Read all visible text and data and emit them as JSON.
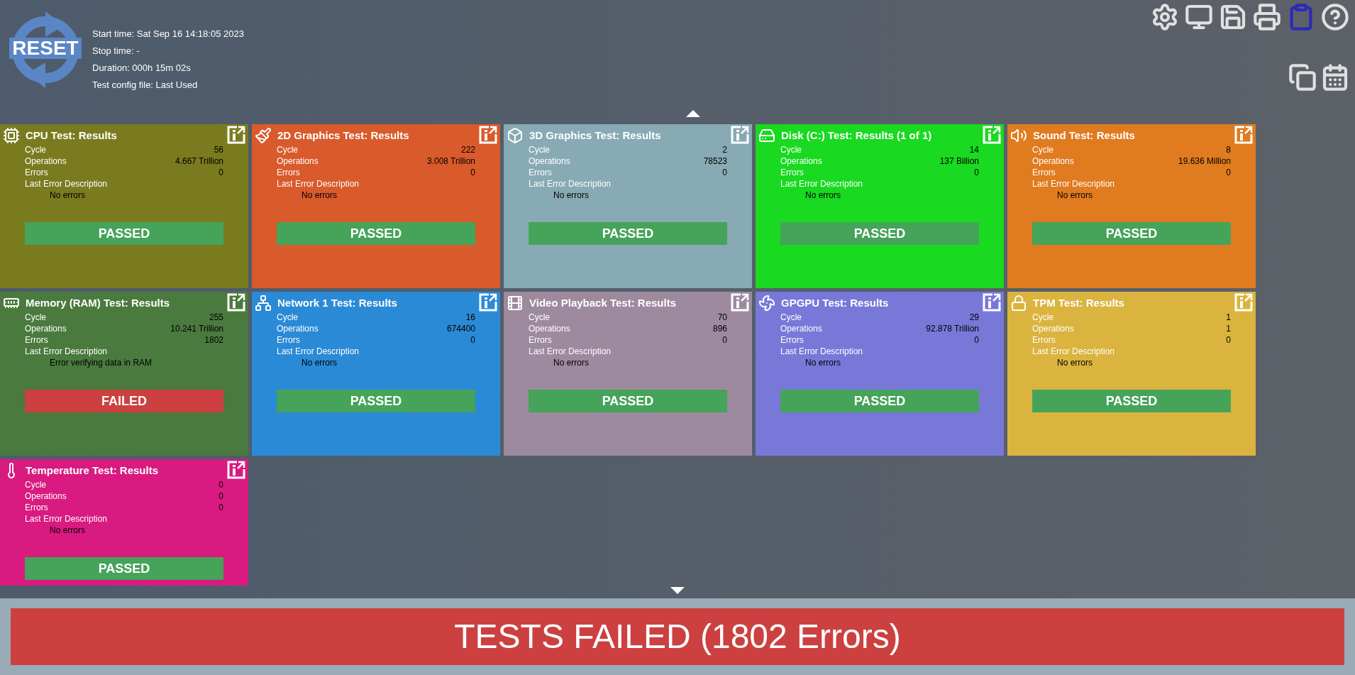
{
  "reset_button": {
    "label": "RESET"
  },
  "session": [
    "Start time: Sat Sep 16 14:18:05 2023",
    "Stop time: -",
    "Duration: 000h 15m 02s",
    "Test config file: Last Used"
  ],
  "cards": [
    {
      "kind": "cpu",
      "title": "CPU Test: Results",
      "color": "#7a7b1f",
      "rows": [
        {
          "label": "Cycle",
          "value": "56"
        },
        {
          "label": "Operations",
          "value": "4.667 Trillion"
        },
        {
          "label": "Errors",
          "value": "0"
        }
      ],
      "description_label": "Last Error Description",
      "description": "No errors",
      "failed": false,
      "status_label": "PASSED"
    },
    {
      "kind": "graphics2d",
      "title": "2D Graphics Test: Results",
      "color": "#d95a2b",
      "rows": [
        {
          "label": "Cycle",
          "value": "222"
        },
        {
          "label": "Operations",
          "value": "3.008 Trillion"
        },
        {
          "label": "Errors",
          "value": "0"
        }
      ],
      "description_label": "Last Error Description",
      "description": "No errors",
      "failed": false,
      "status_label": "PASSED"
    },
    {
      "kind": "graphics3d",
      "title": "3D Graphics Test: Results",
      "color": "#87aab4",
      "rows": [
        {
          "label": "Cycle",
          "value": "2"
        },
        {
          "label": "Operations",
          "value": "78523"
        },
        {
          "label": "Errors",
          "value": "0"
        }
      ],
      "description_label": "Last Error Description",
      "description": "No errors",
      "failed": false,
      "status_label": "PASSED"
    },
    {
      "kind": "disk",
      "title": "Disk (C:) Test: Results (1 of 1)",
      "color": "#19d920",
      "rows": [
        {
          "label": "Cycle",
          "value": "14"
        },
        {
          "label": "Operations",
          "value": "137 Billion"
        },
        {
          "label": "Errors",
          "value": "0"
        }
      ],
      "description_label": "Last Error Description",
      "description": "No errors",
      "failed": false,
      "status_label": "PASSED"
    },
    {
      "kind": "sound",
      "title": "Sound Test: Results",
      "color": "#e07b1f",
      "rows": [
        {
          "label": "Cycle",
          "value": "8"
        },
        {
          "label": "Operations",
          "value": "19.636 Million"
        },
        {
          "label": "Errors",
          "value": "0"
        }
      ],
      "description_label": "Last Error Description",
      "description": "No errors",
      "failed": false,
      "status_label": "PASSED"
    },
    {
      "kind": "memory",
      "title": "Memory (RAM) Test: Results",
      "color": "#4a7a3e",
      "rows": [
        {
          "label": "Cycle",
          "value": "255"
        },
        {
          "label": "Operations",
          "value": "10.241 Trillion"
        },
        {
          "label": "Errors",
          "value": "1802"
        }
      ],
      "description_label": "Last Error Description",
      "description": "Error verifying data in RAM",
      "failed": true,
      "status_label": "FAILED"
    },
    {
      "kind": "network",
      "title": "Network 1 Test: Results",
      "color": "#2b8ad6",
      "rows": [
        {
          "label": "Cycle",
          "value": "16"
        },
        {
          "label": "Operations",
          "value": "674400"
        },
        {
          "label": "Errors",
          "value": "0"
        }
      ],
      "description_label": "Last Error Description",
      "description": "No errors",
      "failed": false,
      "status_label": "PASSED"
    },
    {
      "kind": "video",
      "title": "Video Playback Test: Results",
      "color": "#9d8a9f",
      "rows": [
        {
          "label": "Cycle",
          "value": "70"
        },
        {
          "label": "Operations",
          "value": "896"
        },
        {
          "label": "Errors",
          "value": "0"
        }
      ],
      "description_label": "Last Error Description",
      "description": "No errors",
      "failed": false,
      "status_label": "PASSED"
    },
    {
      "kind": "gpgpu",
      "title": "GPGPU Test: Results",
      "color": "#7878d9",
      "rows": [
        {
          "label": "Cycle",
          "value": "29"
        },
        {
          "label": "Operations",
          "value": "92.878 Trillion"
        },
        {
          "label": "Errors",
          "value": "0"
        }
      ],
      "description_label": "Last Error Description",
      "description": "No errors",
      "failed": false,
      "status_label": "PASSED"
    },
    {
      "kind": "tpm",
      "title": "TPM Test: Results",
      "color": "#dab43f",
      "rows": [
        {
          "label": "Cycle",
          "value": "1"
        },
        {
          "label": "Operations",
          "value": "1"
        },
        {
          "label": "Errors",
          "value": "0"
        }
      ],
      "description_label": "Last Error Description",
      "description": "No errors",
      "failed": false,
      "status_label": "PASSED"
    },
    {
      "kind": "temperature",
      "title": "Temperature Test: Results",
      "color": "#d91a80",
      "rows": [
        {
          "label": "Cycle",
          "value": "0"
        },
        {
          "label": "Operations",
          "value": "0"
        },
        {
          "label": "Errors",
          "value": "0"
        }
      ],
      "description_label": "Last Error Description",
      "description": "No errors",
      "failed": false,
      "status_label": "PASSED"
    }
  ],
  "banner": {
    "text": "TESTS FAILED (1802 Errors)",
    "failed": true
  }
}
